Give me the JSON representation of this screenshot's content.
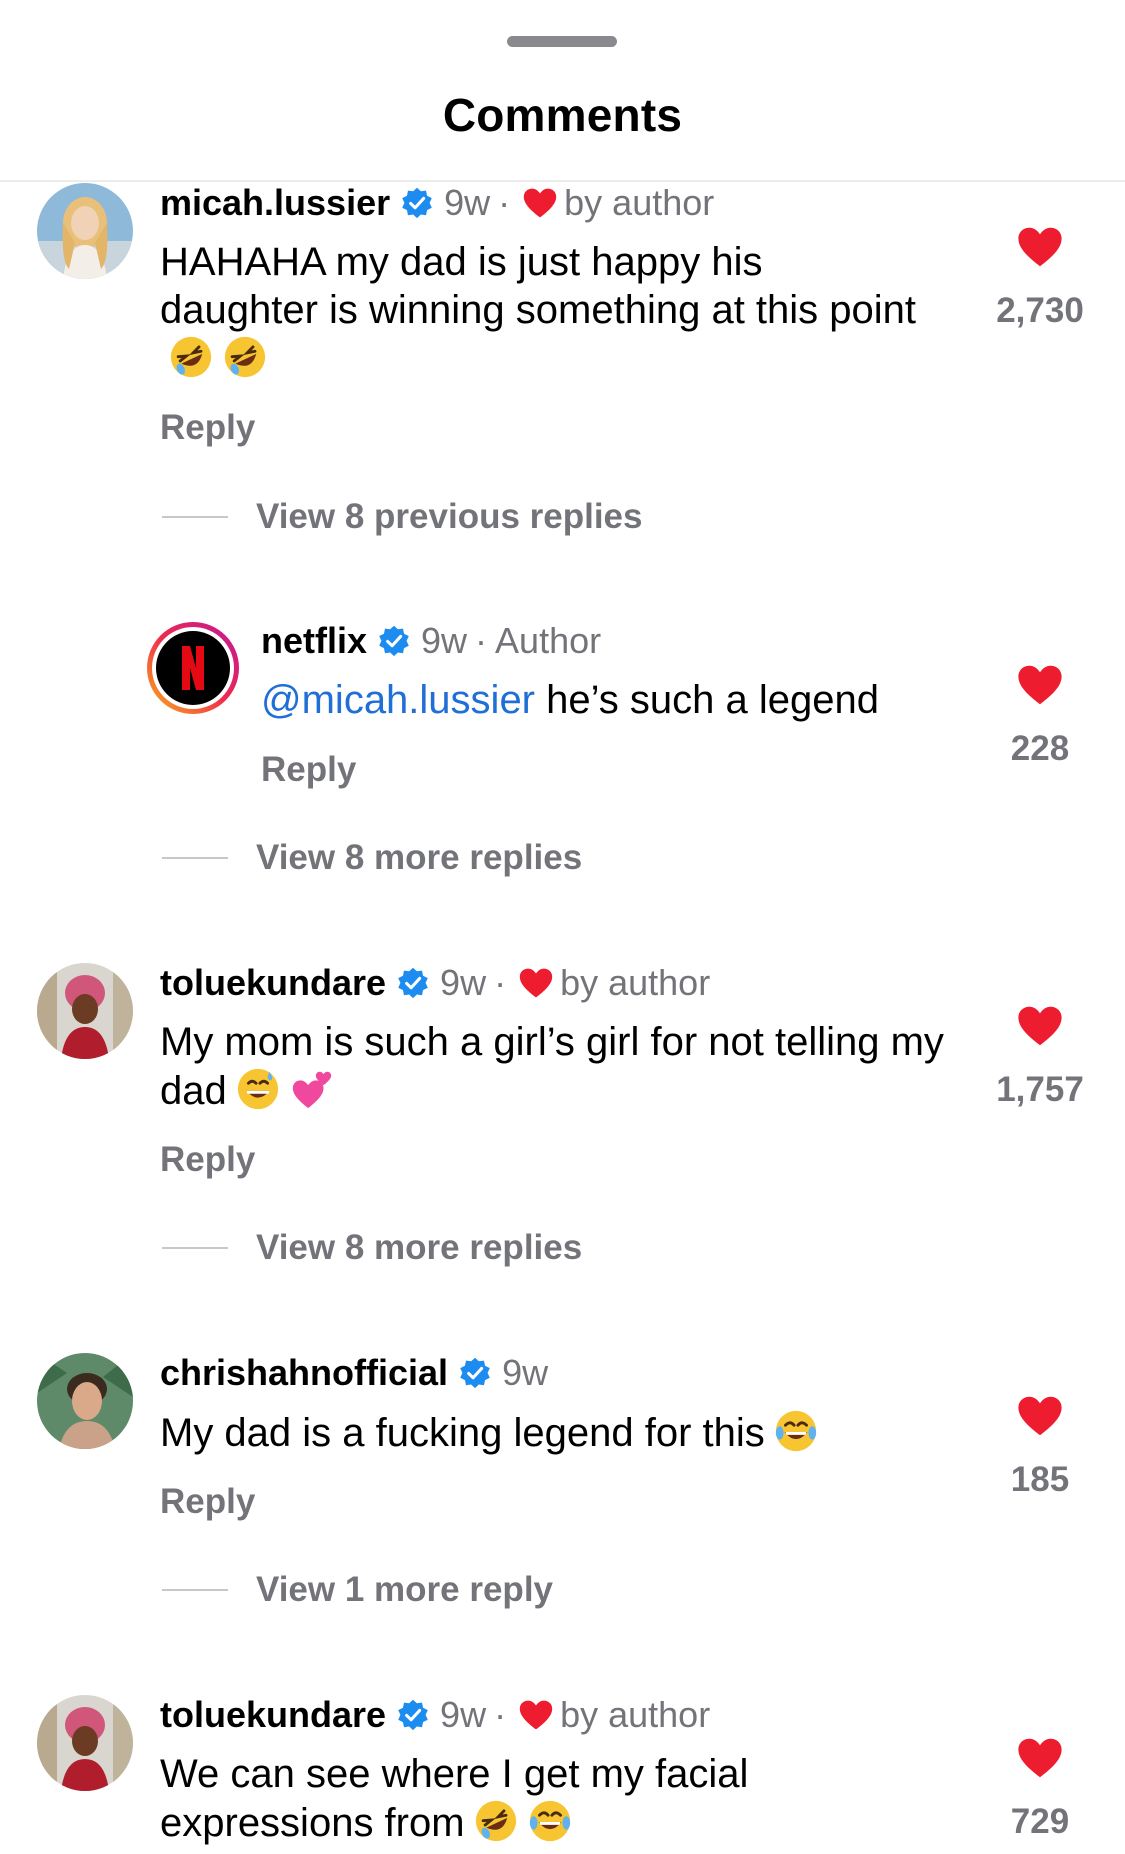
{
  "sheet": {
    "title": "Comments"
  },
  "colors": {
    "accent": "#1f6fd6",
    "heart": "#ed1c2e",
    "verified": "#1d8cf0",
    "muted": "#73737a"
  },
  "comments": [
    {
      "username": "micah.lussier",
      "time": "9w",
      "by_author": "by author",
      "text": "HAHAHA my dad is just happy his daughter is winning something at this point",
      "emojis": [
        "rolling-on-floor-laughing",
        "rolling-on-floor-laughing"
      ],
      "reply_label": "Reply",
      "likes": "2,730",
      "view_replies": "View 8 previous replies"
    },
    {
      "username": "netflix",
      "time": "9w",
      "badge": "Author",
      "mention": "@micah.lussier",
      "text": " he’s such a legend",
      "reply_label": "Reply",
      "likes": "228",
      "view_replies": "View 8 more replies"
    },
    {
      "username": "toluekundare",
      "time": "9w",
      "by_author": "by author",
      "text": "My mom is such a girl’s girl for not telling my dad",
      "emojis": [
        "grinning-sweat",
        "two-hearts"
      ],
      "reply_label": "Reply",
      "likes": "1,757",
      "view_replies": "View 8 more replies"
    },
    {
      "username": "chrishahnofficial",
      "time": "9w",
      "text": "My dad is a fucking legend for this",
      "emojis": [
        "tears-of-joy"
      ],
      "reply_label": "Reply",
      "likes": "185",
      "view_replies": "View 1 more reply"
    },
    {
      "username": "toluekundare",
      "time": "9w",
      "by_author": "by author",
      "text": "We can see where I get my facial expressions from",
      "emojis": [
        "rolling-on-floor-laughing",
        "tears-of-joy"
      ],
      "likes": "729"
    }
  ]
}
